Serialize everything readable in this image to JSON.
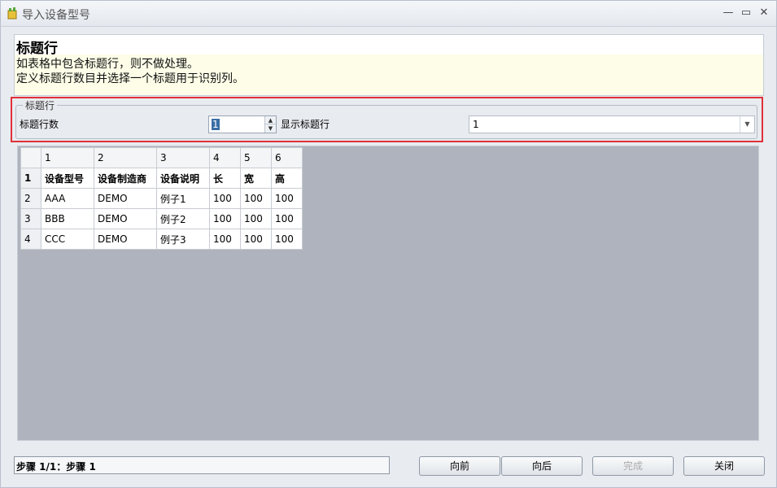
{
  "window": {
    "title": "导入设备型号",
    "icon": "import-icon",
    "controls": {
      "minimize": "—",
      "maximize": "▭",
      "close": "✕"
    }
  },
  "header": {
    "title": "标题行",
    "desc1": "如表格中包含标题行，则不做处理。",
    "desc2": "定义标题行数目并选择一个标题用于识别列。"
  },
  "group": {
    "legend": "标题行",
    "rows_label": "标题行数",
    "rows_value": "1",
    "show_label": "显示标题行",
    "show_value": "1"
  },
  "grid": {
    "column_headers": [
      "1",
      "2",
      "3",
      "4",
      "5",
      "6"
    ],
    "rows": [
      {
        "n": "1",
        "cells": [
          "设备型号",
          "设备制造商",
          "设备说明",
          "长",
          "宽",
          "高"
        ]
      },
      {
        "n": "2",
        "cells": [
          "AAA",
          "DEMO",
          "例子1",
          "100",
          "100",
          "100"
        ]
      },
      {
        "n": "3",
        "cells": [
          "BBB",
          "DEMO",
          "例子2",
          "100",
          "100",
          "100"
        ]
      },
      {
        "n": "4",
        "cells": [
          "CCC",
          "DEMO",
          "例子3",
          "100",
          "100",
          "100"
        ]
      }
    ]
  },
  "status": {
    "text": "步骤 1/1：步骤 1"
  },
  "buttons": {
    "back": "向前",
    "next": "向后",
    "finish": "完成",
    "close": "关闭"
  },
  "colors": {
    "highlight": "#e0303a",
    "grid_bg": "#aeb3bd",
    "header_bg": "#fdfde8"
  }
}
